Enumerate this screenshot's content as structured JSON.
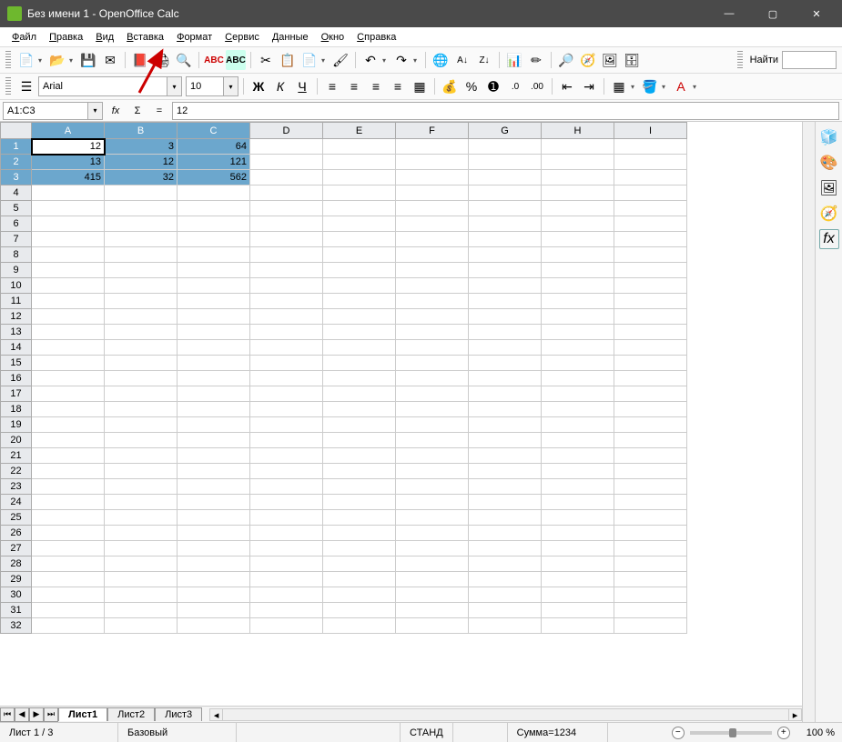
{
  "window": {
    "title": "Без имени 1 - OpenOffice Calc"
  },
  "menu": [
    "Файл",
    "Правка",
    "Вид",
    "Вставка",
    "Формат",
    "Сервис",
    "Данные",
    "Окно",
    "Справка"
  ],
  "toolbar2": {
    "font_name": "Arial",
    "font_size": "10"
  },
  "find_label": "Найти",
  "namebox": "A1:C3",
  "formula_value": "12",
  "columns": [
    "A",
    "B",
    "C",
    "D",
    "E",
    "F",
    "G",
    "H",
    "I"
  ],
  "row_count": 32,
  "selected_cols": [
    "A",
    "B",
    "C"
  ],
  "selected_rows": [
    1,
    2,
    3
  ],
  "active_cell": {
    "row": 1,
    "col": "A"
  },
  "cells": {
    "A1": "12",
    "B1": "3",
    "C1": "64",
    "A2": "13",
    "B2": "12",
    "C2": "121",
    "A3": "415",
    "B3": "32",
    "C3": "562"
  },
  "sheet_tabs": [
    "Лист1",
    "Лист2",
    "Лист3"
  ],
  "active_tab": 0,
  "status": {
    "sheet": "Лист 1 / 3",
    "style": "Базовый",
    "mode": "СТАНД",
    "sum": "Сумма=1234",
    "zoom": "100 %"
  }
}
